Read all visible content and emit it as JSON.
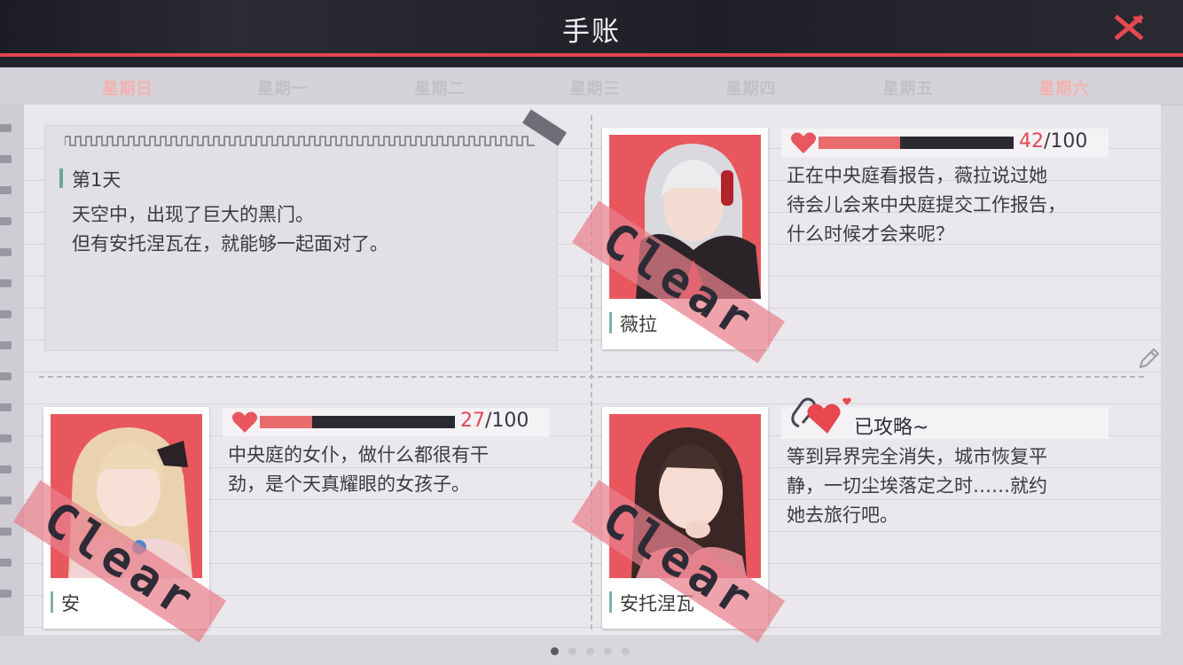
{
  "header": {
    "title": "手账",
    "close_icon": "close-x-icon",
    "accent": "#e0464e"
  },
  "weekdays": [
    {
      "label": "星期日",
      "highlight": true
    },
    {
      "label": "星期一",
      "highlight": false
    },
    {
      "label": "星期二",
      "highlight": false
    },
    {
      "label": "星期三",
      "highlight": false
    },
    {
      "label": "星期四",
      "highlight": false
    },
    {
      "label": "星期五",
      "highlight": false
    },
    {
      "label": "星期六",
      "highlight": true
    }
  ],
  "memo": {
    "day": "第1天",
    "line1": "天空中，出现了巨大的黑门。",
    "line2": "但有安托涅瓦在，就能够一起面对了。"
  },
  "entries": [
    {
      "name": "薇拉",
      "stamp": "Clear",
      "favor_value": "42",
      "favor_max": "/100",
      "favor_fraction": 0.42,
      "desc": [
        "正在中央庭看报告，薇拉说过她",
        "待会儿会来中央庭提交工作报告，",
        "什么时候才会来呢？"
      ]
    },
    {
      "name": "安",
      "stamp": "Clear",
      "favor_value": "27",
      "favor_max": "/100",
      "favor_fraction": 0.27,
      "desc": [
        "中央庭的女仆，做什么都很有干",
        "劲，是个天真耀眼的女孩子。"
      ]
    },
    {
      "name": "安托涅瓦",
      "stamp": "Clear",
      "status": "已攻略~",
      "desc": [
        "等到异界完全消失，城市恢复平",
        "静，一切尘埃落定之时……就约",
        "她去旅行吧。"
      ]
    }
  ],
  "pagination": {
    "count": 5,
    "active": 0
  },
  "icons": {
    "heart": "heart-icon",
    "edit": "pencil-icon",
    "clip": "paperclip-icon"
  }
}
